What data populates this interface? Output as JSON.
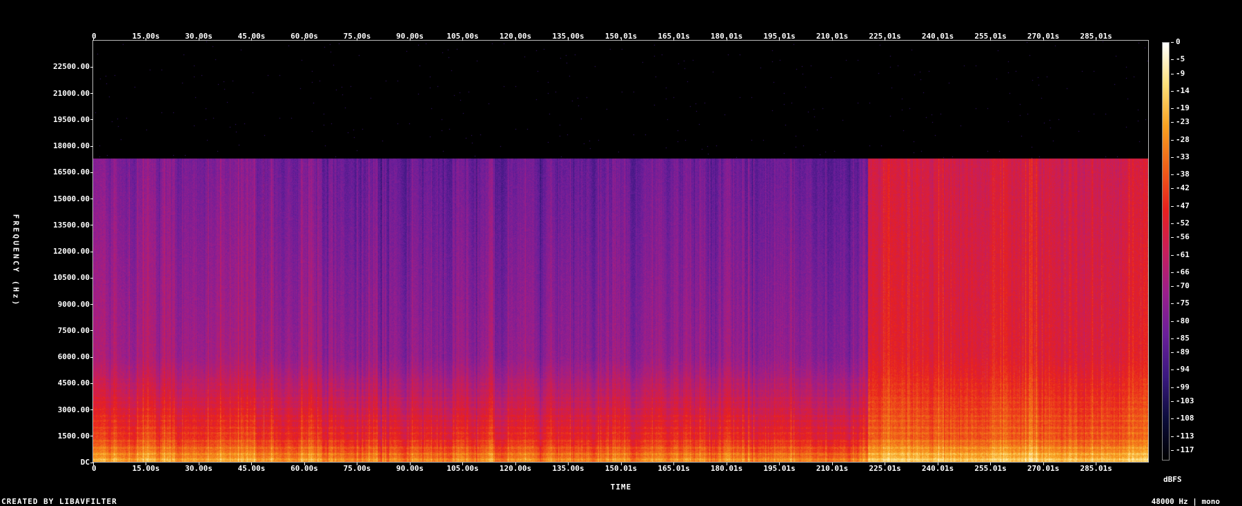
{
  "chart_data": {
    "type": "heatmap",
    "xlabel": "TIME",
    "ylabel": "FREQUENCY (Hz)",
    "x_ticks": [
      "0",
      "15.00s",
      "30.00s",
      "45.00s",
      "60.00s",
      "75.00s",
      "90.00s",
      "105.00s",
      "120.00s",
      "135.00s",
      "150.01s",
      "165.01s",
      "180.01s",
      "195.01s",
      "210.01s",
      "225.01s",
      "240.01s",
      "255.01s",
      "270.01s",
      "285.01s"
    ],
    "x_tick_values": [
      0,
      15,
      30,
      45,
      60,
      75,
      90,
      105,
      120,
      135,
      150.01,
      165.01,
      180.01,
      195.01,
      210.01,
      225.01,
      240.01,
      255.01,
      270.01,
      285.01
    ],
    "xlim": [
      0,
      300
    ],
    "y_ticks": [
      "DC",
      "1500.00",
      "3000.00",
      "4500.00",
      "6000.00",
      "7500.00",
      "9000.00",
      "10500.00",
      "12000.00",
      "13500.00",
      "15000.00",
      "16500.00",
      "18000.00",
      "19500.00",
      "21000.00",
      "22500.00"
    ],
    "y_tick_values": [
      0,
      1500,
      3000,
      4500,
      6000,
      7500,
      9000,
      10500,
      12000,
      13500,
      15000,
      16500,
      18000,
      19500,
      21000,
      22500
    ],
    "ylim": [
      0,
      24000
    ],
    "colorbar": {
      "unit": "dBFS",
      "ticks": [
        "0",
        "-5",
        "-9",
        "-14",
        "-19",
        "-23",
        "-28",
        "-33",
        "-38",
        "-42",
        "-47",
        "-52",
        "-56",
        "-61",
        "-66",
        "-70",
        "-75",
        "-80",
        "-85",
        "-89",
        "-94",
        "-99",
        "-103",
        "-108",
        "-113",
        "-117"
      ],
      "range": [
        -120,
        0
      ],
      "colors": [
        "#000000",
        "#0c0d3c",
        "#3a1880",
        "#6a1e9a",
        "#9a1e8c",
        "#c81e5a",
        "#e8201e",
        "#f06018",
        "#f8a020",
        "#fde07a",
        "#ffffff"
      ]
    },
    "cutoff_hz": 17300,
    "sections": [
      {
        "start_s": 0,
        "end_s": 65,
        "low_band_db": -45,
        "mid_band_db": -70,
        "high_band_db": -80
      },
      {
        "start_s": 65,
        "end_s": 220,
        "low_band_db": -50,
        "mid_band_db": -75,
        "high_band_db": -85
      },
      {
        "start_s": 220,
        "end_s": 300,
        "low_band_db": -38,
        "mid_band_db": -52,
        "high_band_db": -57
      }
    ]
  },
  "footer": {
    "credit": "CREATED BY LIBAVFILTER",
    "format": "48000 Hz | mono"
  }
}
